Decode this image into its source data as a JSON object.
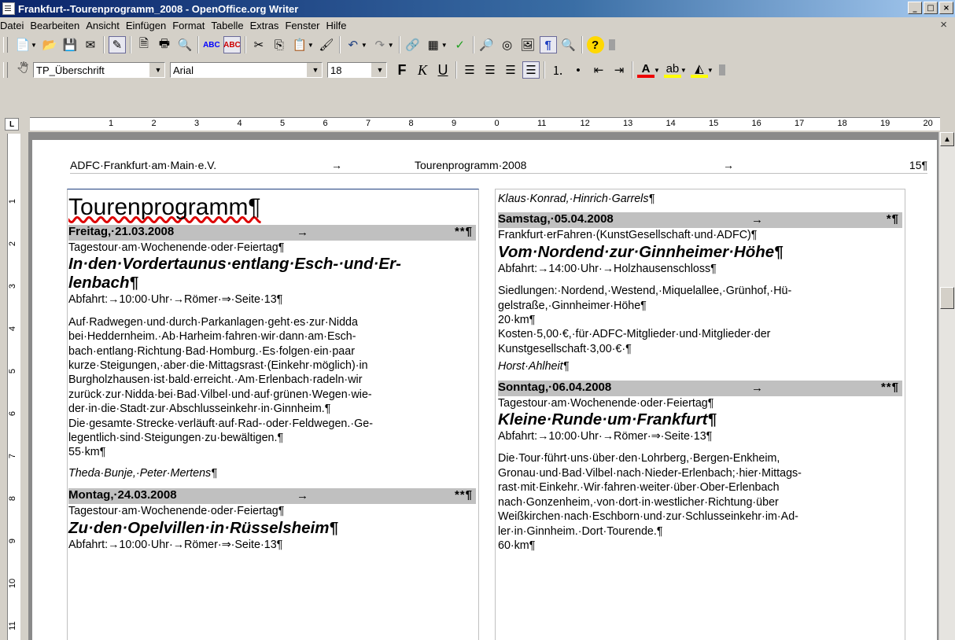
{
  "window": {
    "title": "Frankfurt--Tourenprogramm_2008 - OpenOffice.org Writer",
    "min": "_",
    "max": "□",
    "close": "×",
    "doc_close": "×"
  },
  "menu": [
    "Datei",
    "Bearbeiten",
    "Ansicht",
    "Einfügen",
    "Format",
    "Tabelle",
    "Extras",
    "Fenster",
    "Hilfe"
  ],
  "format_bar": {
    "paragraph_style": "TP_Überschrift",
    "font_name": "Arial",
    "font_size": "18",
    "bold": "F",
    "italic": "K",
    "underline": "U"
  },
  "ruler": {
    "numbers": [
      "1",
      "2",
      "3",
      "4",
      "5",
      "6",
      "7",
      "8",
      "9",
      "0",
      "11",
      "12",
      "13",
      "14",
      "15",
      "16",
      "17",
      "18",
      "19",
      "20"
    ],
    "vnumbers": [
      "1",
      "2",
      "3",
      "4",
      "5",
      "6",
      "7",
      "8",
      "9",
      "10",
      "11"
    ]
  },
  "header": {
    "left": "ADFC·Frankfurt·am·Main·e.V.",
    "tab1": "→",
    "center": "Tourenprogramm·2008",
    "tab2": "→",
    "right": "15¶"
  },
  "left_col": {
    "heading": "Tourenprogramm¶",
    "t1": {
      "day": "Freitag,·21.03.2008",
      "arrow": "→",
      "stars": "**¶",
      "type": "Tagestour·am·Wochenende·oder·Feiertag¶",
      "title1": "In·den·Vordertaunus·entlang·Esch-·und·Er-",
      "title2": "lenbach¶",
      "abfahrt": "Abfahrt:→10:00·Uhr·→Römer·⇒·Seite·13¶",
      "desc": [
        "Auf·Radwegen·und·durch·Parkanlagen·geht·es·zur·Nidda",
        "bei·Heddernheim.·Ab·Harheim·fahren·wir·dann·am·Esch-",
        "bach·entlang·Richtung·Bad·Homburg.·Es·folgen·ein·paar",
        "kurze·Steigungen,·aber·die·Mittagsrast·(Einkehr·möglich)·in",
        "Burgholzhausen·ist·bald·erreicht.·Am·Erlenbach·radeln·wir",
        "zurück·zur·Nidda·bei·Bad·Vilbel·und·auf·grünen·Wegen·wie-",
        "der·in·die·Stadt·zur·Abschlusseinkehr·in·Ginnheim.¶"
      ],
      "desc2": [
        "Die·gesamte·Strecke·verläuft·auf·Rad-·oder·Feldwegen.·Ge-",
        "legentlich·sind·Steigungen·zu·bewältigen.¶"
      ],
      "km": "55·km¶",
      "leaders": "Theda·Bunje,·Peter·Mertens¶"
    },
    "t2": {
      "day": "Montag,·24.03.2008",
      "arrow": "→",
      "stars": "**¶",
      "type": "Tagestour·am·Wochenende·oder·Feiertag¶",
      "title": "Zu·den·Opelvillen·in·Rüsselsheim¶",
      "abfahrt": "Abfahrt:→10:00·Uhr·→Römer·⇒·Seite·13¶"
    }
  },
  "right_col": {
    "leaders_top": "Klaus·Konrad,·Hinrich·Garrels¶",
    "t1": {
      "day": "Samstag,·05.04.2008",
      "arrow": "→",
      "stars": "*¶",
      "type": "Frankfurt·erFahren·(KunstGesellschaft·und·ADFC)¶",
      "title": "Vom·Nordend·zur·Ginnheimer·Höhe¶",
      "abfahrt": "Abfahrt:→14:00·Uhr·→Holzhausenschloss¶",
      "desc": [
        "Siedlungen:·Nordend,·Westend,·Miquelallee,·Grünhof,·Hü-",
        "gelstraße,·Ginnheimer·Höhe¶"
      ],
      "km": "20·km¶",
      "cost": [
        "Kosten·5,00·€,·für·ADFC-Mitglieder·und·Mitglieder·der",
        "Kunstgesellschaft·3,00·€·¶"
      ],
      "leader": "Horst·Ahlheit¶"
    },
    "t2": {
      "day": "Sonntag,·06.04.2008",
      "arrow": "→",
      "stars": "**¶",
      "type": "Tagestour·am·Wochenende·oder·Feiertag¶",
      "title": "Kleine·Runde·um·Frankfurt¶",
      "abfahrt": "Abfahrt:→10:00·Uhr·→Römer·⇒·Seite·13¶",
      "desc": [
        "Die·Tour·führt·uns·über·den·Lohrberg,·Bergen-Enkheim,",
        "Gronau·und·Bad·Vilbel·nach·Nieder-Erlenbach;·hier·Mittags-",
        "rast·mit·Einkehr.·Wir·fahren·weiter·über·Ober-Erlenbach",
        "nach·Gonzenheim,·von·dort·in·westlicher·Richtung·über",
        "Weißkirchen·nach·Eschborn·und·zur·Schlusseinkehr·im·Ad-",
        "ler·in·Ginnheim.·Dort·Tourende.¶"
      ],
      "km": "60·km¶"
    }
  }
}
